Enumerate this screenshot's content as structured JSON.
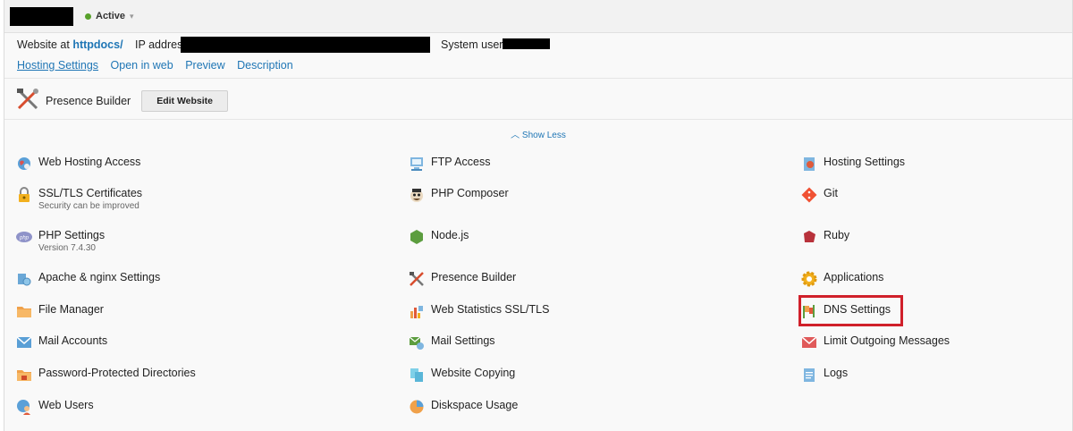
{
  "header": {
    "status": "Active"
  },
  "info": {
    "website_prefix": "Website at",
    "website_link": "httpdocs/",
    "ip_label": "IP address:",
    "system_user_label": "System user:"
  },
  "links": [
    "Hosting Settings",
    "Open in web",
    "Preview",
    "Description"
  ],
  "presence_builder": {
    "label": "Presence Builder",
    "button": "Edit Website"
  },
  "show_less": "Show Less",
  "columns": [
    [
      {
        "label": "Web Hosting Access",
        "icon": "globe-icon"
      },
      {
        "label": "SSL/TLS Certificates",
        "sub": "Security can be improved",
        "icon": "lock-icon"
      },
      {
        "label": "PHP Settings",
        "sub": "Version 7.4.30",
        "icon": "php-icon"
      },
      {
        "label": "Apache & nginx Settings",
        "icon": "server-settings-icon"
      },
      {
        "label": "File Manager",
        "icon": "folder-icon"
      },
      {
        "label": "Mail Accounts",
        "icon": "envelope-icon"
      },
      {
        "label": "Password-Protected Directories",
        "icon": "locked-folder-icon"
      },
      {
        "label": "Web Users",
        "icon": "web-users-icon"
      }
    ],
    [
      {
        "label": "FTP Access",
        "icon": "ftp-icon"
      },
      {
        "label": "PHP Composer",
        "icon": "composer-icon"
      },
      {
        "label": "Node.js",
        "icon": "nodejs-icon"
      },
      {
        "label": "Presence Builder",
        "icon": "presence-builder-icon"
      },
      {
        "label": "Web Statistics SSL/TLS",
        "icon": "statistics-icon"
      },
      {
        "label": "Mail Settings",
        "icon": "mail-settings-icon"
      },
      {
        "label": "Website Copying",
        "icon": "copy-icon"
      },
      {
        "label": "Diskspace Usage",
        "icon": "pie-chart-icon"
      }
    ],
    [
      {
        "label": "Hosting Settings",
        "icon": "hosting-settings-icon"
      },
      {
        "label": "Git",
        "icon": "git-icon"
      },
      {
        "label": "Ruby",
        "icon": "ruby-icon"
      },
      {
        "label": "Applications",
        "icon": "gear-icon"
      },
      {
        "label": "DNS Settings",
        "icon": "dns-icon"
      },
      {
        "label": "Limit Outgoing Messages",
        "icon": "limit-mail-icon"
      },
      {
        "label": "Logs",
        "icon": "logs-icon"
      }
    ]
  ]
}
